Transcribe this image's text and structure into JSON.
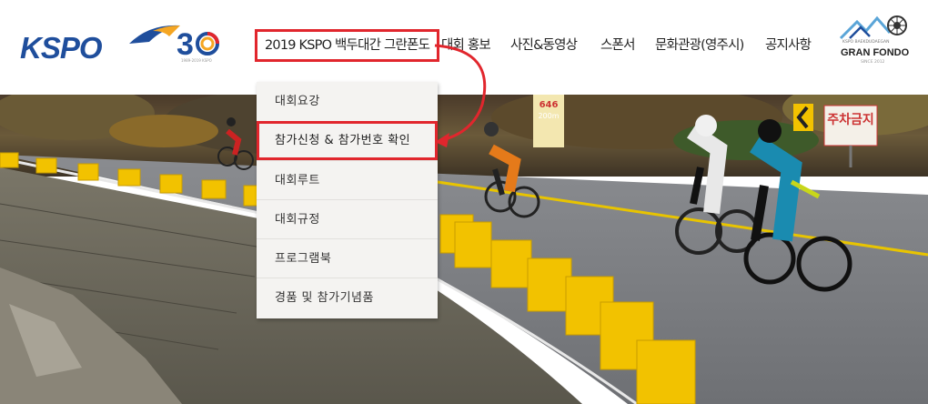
{
  "header": {
    "logo_text": "KSPO",
    "anniversary_text": "1989-2019 KSPO",
    "nav": [
      {
        "label": "2019 KSPO 백두대간 그란폰도",
        "active": true
      },
      {
        "label": "대회 홍보"
      },
      {
        "label": "사진&동영상"
      },
      {
        "label": "스폰서"
      },
      {
        "label": "문화관광(영주시)"
      },
      {
        "label": "공지사항"
      }
    ],
    "granfondo": {
      "sub": "KSPO BAEKDUDAEGAN",
      "title": "GRAN FONDO",
      "since": "SINCE 2012"
    }
  },
  "dropdown": {
    "items": [
      {
        "label": "대회요강"
      },
      {
        "label": "참가신청 & 참가번호 확인",
        "highlight": true
      },
      {
        "label": "대회루트"
      },
      {
        "label": "대회규정"
      },
      {
        "label": "프로그램북"
      },
      {
        "label": "경품 및 참가기념품"
      }
    ]
  },
  "hero": {
    "sign_parking": "주차금지",
    "sign_distance": "646",
    "sign_distance2": "200m"
  },
  "colors": {
    "highlight": "#e1262d",
    "brand_blue": "#1f4e9c",
    "brand_orange": "#f5a623",
    "guardrail_yellow": "#f2c200"
  }
}
